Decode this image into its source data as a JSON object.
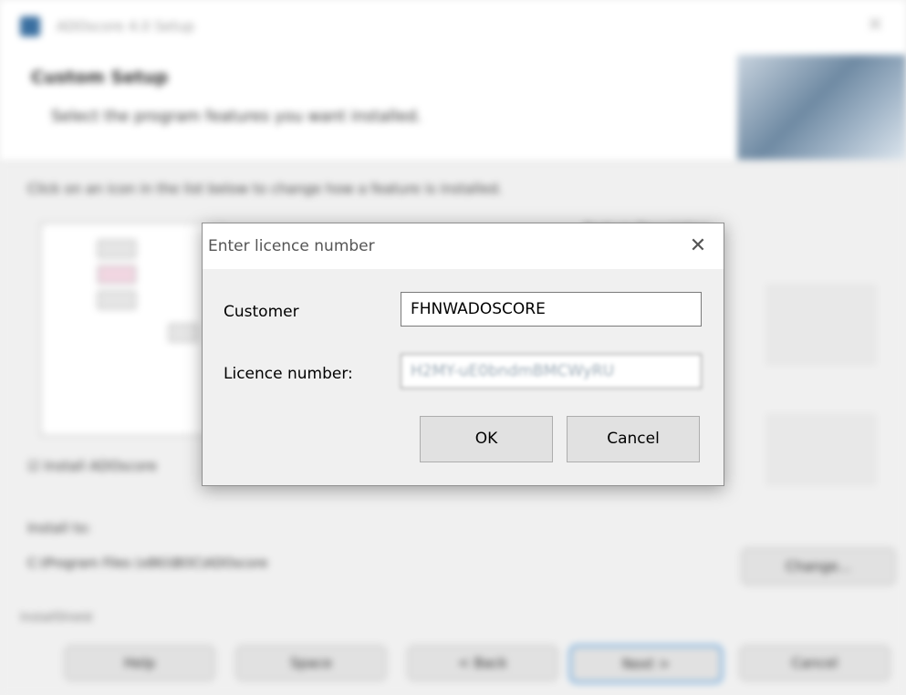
{
  "background": {
    "window_title": "ADOscore 4.0 Setup",
    "header_title": "Custom Setup",
    "header_subtitle": "Select the program features you want installed.",
    "instruction": "Click on an icon in the list below to change how a feature is installed.",
    "description": "Feature Description",
    "install_all_label": "Install ADOscore",
    "install_to_label": "Install to:",
    "install_path": "C:\\Program Files (x86)\\BOC\\ADOscore",
    "change_label": "Change...",
    "footer_label": "InstallShield",
    "buttons": {
      "help": "Help",
      "space": "Space",
      "back": "< Back",
      "next": "Next >",
      "cancel": "Cancel"
    }
  },
  "dialog": {
    "title": "Enter licence number",
    "close_glyph": "✕",
    "customer_label": "Customer",
    "customer_value": "FHNWADOSCORE",
    "licence_label": "Licence number:",
    "licence_value": "H2MY-uE0bndmBMCWyRU",
    "ok_label": "OK",
    "cancel_label": "Cancel"
  }
}
